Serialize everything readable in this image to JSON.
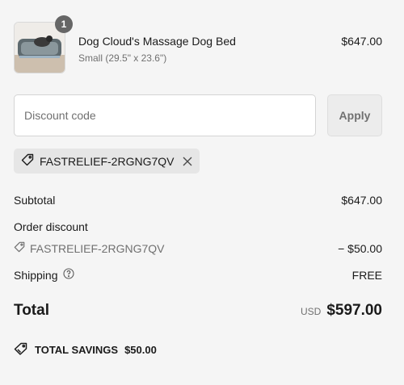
{
  "product": {
    "quantity": "1",
    "name": "Dog Cloud's Massage Dog Bed",
    "variant": "Small (29.5\" x 23.6\")",
    "price": "$647.00"
  },
  "discount": {
    "placeholder": "Discount code",
    "apply_label": "Apply",
    "applied_code": "FASTRELIEF-2RGNG7QV"
  },
  "summary": {
    "subtotal_label": "Subtotal",
    "subtotal_value": "$647.00",
    "order_discount_label": "Order discount",
    "order_discount_code": "FASTRELIEF-2RGNG7QV",
    "order_discount_value": "− $50.00",
    "shipping_label": "Shipping",
    "shipping_value": "FREE",
    "total_label": "Total",
    "currency": "USD",
    "total_value": "$597.00",
    "savings_label": "TOTAL SAVINGS",
    "savings_value": "$50.00"
  },
  "icons": {
    "tag": "tag-icon",
    "close": "close-icon",
    "help": "help-circle-icon",
    "savings": "tag-icon"
  }
}
